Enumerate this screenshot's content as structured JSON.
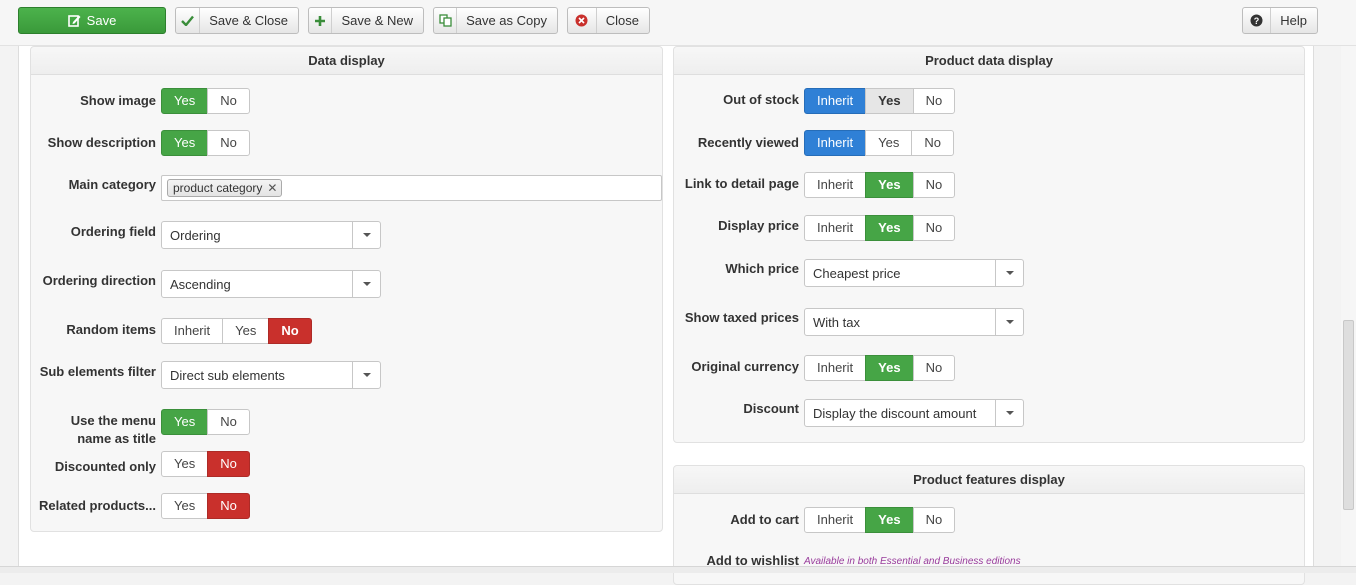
{
  "toolbar": {
    "save": "Save",
    "save_close": "Save & Close",
    "save_new": "Save & New",
    "save_copy": "Save as Copy",
    "close": "Close",
    "help": "Help"
  },
  "data_display": {
    "title": "Data display",
    "show_image": {
      "label": "Show image",
      "yes": "Yes",
      "no": "No",
      "selected": "Yes"
    },
    "show_description": {
      "label": "Show description",
      "yes": "Yes",
      "no": "No",
      "selected": "Yes"
    },
    "main_category": {
      "label": "Main category",
      "tag": "product category",
      "tag_remove": "✕"
    },
    "ordering_field": {
      "label": "Ordering field",
      "value": "Ordering"
    },
    "ordering_direction": {
      "label": "Ordering direction",
      "value": "Ascending"
    },
    "random_items": {
      "label": "Random items",
      "inherit": "Inherit",
      "yes": "Yes",
      "no": "No",
      "selected": "No"
    },
    "sub_elements_filter": {
      "label": "Sub elements filter",
      "value": "Direct sub elements"
    },
    "use_menu_name": {
      "label_line1": "Use the menu",
      "label_line2": "name as title",
      "yes": "Yes",
      "no": "No",
      "selected": "Yes"
    },
    "discounted_only": {
      "label": "Discounted only",
      "yes": "Yes",
      "no": "No",
      "selected": "No"
    },
    "related_products": {
      "label": "Related products...",
      "yes": "Yes",
      "no": "No",
      "selected": "No"
    }
  },
  "product_data_display": {
    "title": "Product data display",
    "out_of_stock": {
      "label": "Out of stock",
      "inherit": "Inherit",
      "yes": "Yes",
      "no": "No",
      "selected": "Inherit"
    },
    "recently_viewed": {
      "label": "Recently viewed",
      "inherit": "Inherit",
      "yes": "Yes",
      "no": "No",
      "selected": "Inherit"
    },
    "link_detail": {
      "label": "Link to detail page",
      "inherit": "Inherit",
      "yes": "Yes",
      "no": "No",
      "selected": "Yes"
    },
    "display_price": {
      "label": "Display price",
      "inherit": "Inherit",
      "yes": "Yes",
      "no": "No",
      "selected": "Yes"
    },
    "which_price": {
      "label": "Which price",
      "value": "Cheapest price"
    },
    "show_taxed_prices": {
      "label": "Show taxed prices",
      "value": "With tax"
    },
    "original_currency": {
      "label": "Original currency",
      "inherit": "Inherit",
      "yes": "Yes",
      "no": "No",
      "selected": "Yes"
    },
    "discount": {
      "label": "Discount",
      "value": "Display the discount amount"
    }
  },
  "product_features_display": {
    "title": "Product features display",
    "add_to_cart": {
      "label": "Add to cart",
      "inherit": "Inherit",
      "yes": "Yes",
      "no": "No",
      "selected": "Yes"
    },
    "add_to_wishlist": {
      "label": "Add to wishlist",
      "note": "Available in both Essential and Business editions"
    }
  },
  "colors": {
    "green": "#46a546",
    "red": "#c9302c",
    "blue": "#2f80d6",
    "promo": "#993c9c"
  }
}
